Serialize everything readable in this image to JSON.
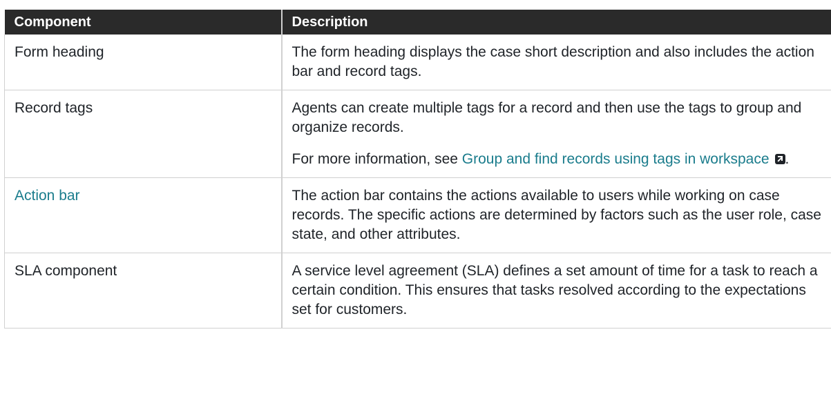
{
  "table": {
    "headers": [
      "Component",
      "Description"
    ],
    "rows": [
      {
        "component": "Form heading",
        "description": "The form heading displays the case short description and also includes the action bar and record tags."
      },
      {
        "component": "Record tags",
        "description": "Agents can create multiple tags for a record and then use the tags to group and organize records.",
        "more_prefix": "For more information, see ",
        "more_link": "Group and find records using tags in workspace",
        "more_suffix": "."
      },
      {
        "component": "Action bar",
        "description": "The action bar contains the actions available to users while working on case records. The specific actions are determined by factors such as the user role, case state, and other attributes."
      },
      {
        "component": "SLA component",
        "description": "A service level agreement (SLA) defines a set amount of time for a task to reach a certain condition. This ensures that tasks resolved according to the expectations set for customers."
      }
    ]
  },
  "icons": {
    "external_link": "external-link-icon"
  },
  "colors": {
    "header_bg": "#2a2a2a",
    "link": "#1a7c8c"
  }
}
